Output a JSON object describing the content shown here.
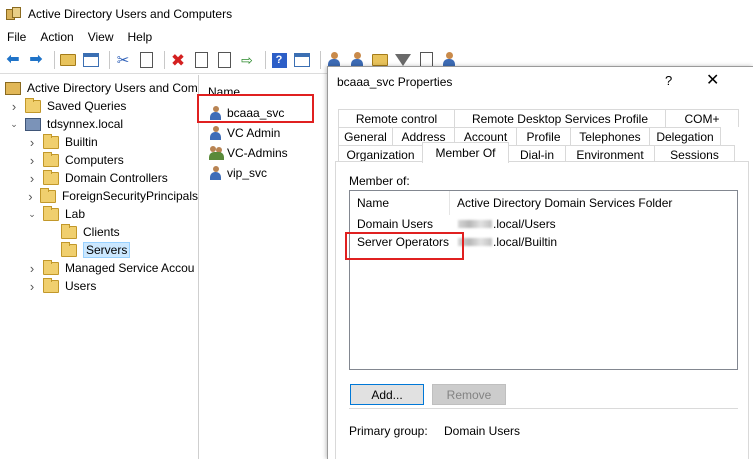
{
  "window": {
    "title": "Active Directory Users and Computers"
  },
  "menu": [
    "File",
    "Action",
    "View",
    "Help"
  ],
  "toolbar": {
    "icons": [
      "back-arrow-icon",
      "forward-arrow-icon",
      "up-folder-icon",
      "show-tree-icon",
      "cut-icon",
      "copy-icon",
      "delete-icon",
      "properties-icon",
      "refresh-icon",
      "export-icon",
      "help-icon",
      "console-icon",
      "new-user-icon",
      "new-group-icon",
      "new-ou-icon",
      "filter-icon",
      "find-icon",
      "add-to-group-icon"
    ]
  },
  "tree": {
    "root": "Active Directory Users and Com",
    "items": [
      {
        "label": "Saved Queries",
        "level": 1,
        "expander": "collapsed",
        "icon": "folder"
      },
      {
        "label": "tdsynnex.local",
        "level": 1,
        "expander": "expanded",
        "icon": "domain"
      },
      {
        "label": "Builtin",
        "level": 2,
        "expander": "collapsed",
        "icon": "folder"
      },
      {
        "label": "Computers",
        "level": 2,
        "expander": "collapsed",
        "icon": "folder"
      },
      {
        "label": "Domain Controllers",
        "level": 2,
        "expander": "collapsed",
        "icon": "folder"
      },
      {
        "label": "ForeignSecurityPrincipals",
        "level": 2,
        "expander": "collapsed",
        "icon": "folder"
      },
      {
        "label": "Lab",
        "level": 2,
        "expander": "expanded",
        "icon": "folder"
      },
      {
        "label": "Clients",
        "level": 3,
        "expander": "none",
        "icon": "folder"
      },
      {
        "label": "Servers",
        "level": 3,
        "expander": "none",
        "icon": "folder",
        "selected": true
      },
      {
        "label": "Managed Service Accou",
        "level": 2,
        "expander": "collapsed",
        "icon": "folder"
      },
      {
        "label": "Users",
        "level": 2,
        "expander": "collapsed",
        "icon": "folder"
      }
    ]
  },
  "list": {
    "header": "Name",
    "items": [
      {
        "label": "bcaaa_svc",
        "icon": "user"
      },
      {
        "label": "VC Admin",
        "icon": "user"
      },
      {
        "label": "VC-Admins",
        "icon": "group"
      },
      {
        "label": "vip_svc",
        "icon": "user"
      }
    ]
  },
  "dialog": {
    "title": "bcaaa_svc Properties",
    "help": "?",
    "close": "✕",
    "tabs_row1": [
      "Remote control",
      "Remote Desktop Services Profile",
      "COM+"
    ],
    "tabs_row2": [
      "General",
      "Address",
      "Account",
      "Profile",
      "Telephones",
      "Delegation"
    ],
    "tabs_row3": [
      "Organization",
      "Member Of",
      "Dial-in",
      "Environment",
      "Sessions"
    ],
    "active_tab": "Member Of",
    "member_of_label": "Member of:",
    "columns": [
      "Name",
      "Active Directory Domain Services Folder"
    ],
    "rows": [
      {
        "name": "Domain Users",
        "folder": ".local/Users"
      },
      {
        "name": "Server Operators",
        "folder": ".local/Builtin"
      }
    ],
    "add_button": "Add...",
    "remove_button": "Remove",
    "primary_group_label": "Primary group:",
    "primary_group_value": "Domain Users"
  }
}
